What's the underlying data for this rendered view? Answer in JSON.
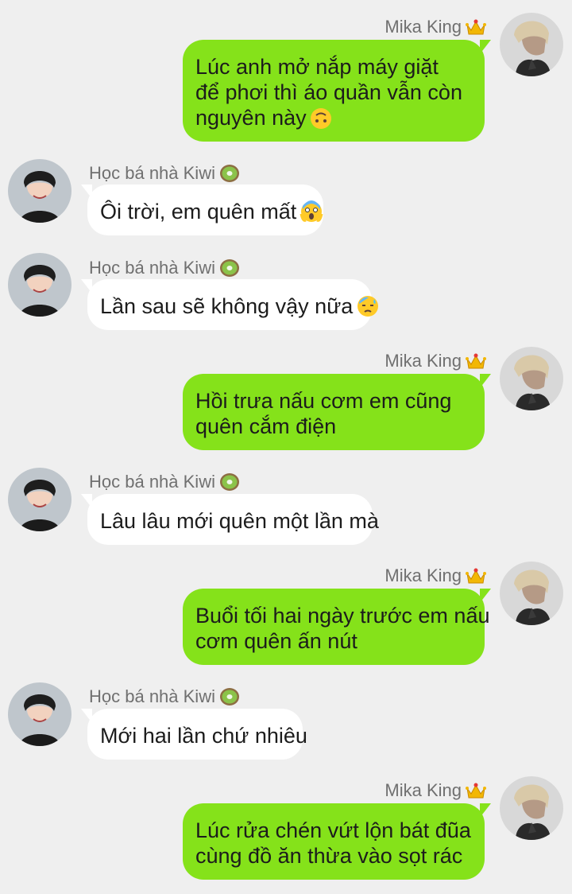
{
  "conversation": {
    "messages": [
      {
        "side": "right",
        "sender": "Mika King",
        "sender_badge": "crown-icon",
        "lines": [
          "Lúc anh mở nắp máy giặt",
          "để phơi thì áo quần vẫn còn",
          "nguyên này"
        ],
        "trailing_emoji": "upside-down-face-emoji"
      },
      {
        "side": "left",
        "sender": "Học bá nhà Kiwi",
        "sender_badge": "kiwi-icon",
        "lines": [
          "Ôi trời, em quên mất"
        ],
        "trailing_emoji": "screaming-face-emoji"
      },
      {
        "side": "left",
        "sender": "Học bá nhà Kiwi",
        "sender_badge": "kiwi-icon",
        "lines": [
          "Lần sau sẽ không vậy nữa"
        ],
        "trailing_emoji": "downcast-sweat-face-emoji"
      },
      {
        "side": "right",
        "sender": "Mika King",
        "sender_badge": "crown-icon",
        "lines": [
          "Hồi trưa nấu cơm em cũng",
          "quên cắm điện"
        ]
      },
      {
        "side": "left",
        "sender": "Học bá nhà Kiwi",
        "sender_badge": "kiwi-icon",
        "lines": [
          "Lâu lâu mới quên một lần mà"
        ]
      },
      {
        "side": "right",
        "sender": "Mika King",
        "sender_badge": "crown-icon",
        "lines": [
          "Buổi tối hai ngày trước em nấu",
          "cơm quên ấn nút"
        ]
      },
      {
        "side": "left",
        "sender": "Học bá nhà Kiwi",
        "sender_badge": "kiwi-icon",
        "lines": [
          "Mới hai lần chứ nhiêu"
        ]
      },
      {
        "side": "right",
        "sender": "Mika King",
        "sender_badge": "crown-icon",
        "lines": [
          "Lúc rửa chén vứt lộn bát đũa",
          "cùng đồ ăn thừa vào sọt rác"
        ]
      }
    ]
  },
  "colors": {
    "background": "#efefef",
    "outgoing_bubble": "#85e21a",
    "incoming_bubble": "#ffffff",
    "sender_name": "#707070"
  }
}
